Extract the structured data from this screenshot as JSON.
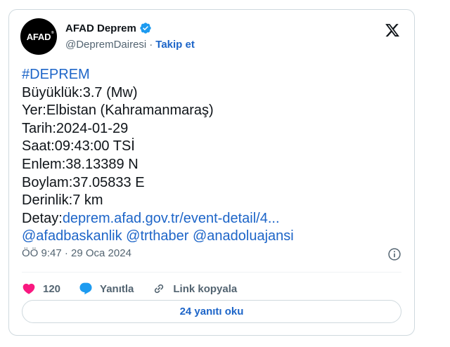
{
  "author": {
    "avatar_text": "AFAD",
    "display_name": "AFAD Deprem",
    "handle": "@DepremDairesi",
    "separator": "·",
    "follow_label": "Takip et"
  },
  "tweet": {
    "lines": [
      "#DEPREM",
      "Büyüklük:3.7 (Mw)",
      "Yer:Elbistan (Kahramanmaraş)",
      "Tarih:2024-01-29",
      "Saat:09:43:00 TSİ",
      "Enlem:38.13389 N",
      "Boylam:37.05833 E",
      "Derinlik:7 km"
    ],
    "detail_prefix": "Detay:",
    "detail_link": "deprem.afad.gov.tr/event-detail/4...",
    "mentions": [
      "@afadbaskanlik",
      "@trthaber",
      "@anadoluajansi"
    ]
  },
  "meta": {
    "timestamp": "ÖÖ 9:47 · 29 Oca 2024"
  },
  "actions": {
    "like_count": "120",
    "reply_label": "Yanıtla",
    "copy_link_label": "Link kopyala"
  },
  "replies_button_label": "24 yanıtı oku",
  "colors": {
    "link": "#1d65c8",
    "like": "#f91880",
    "reply_icon": "#1d9bf0",
    "verified": "#1d9bf0",
    "muted_text": "#536471"
  },
  "icons": {
    "verified": "verified-badge-icon",
    "brand": "x-logo-icon",
    "info": "info-icon",
    "like": "heart-icon",
    "reply": "speech-bubble-icon",
    "copy_link": "link-icon"
  }
}
